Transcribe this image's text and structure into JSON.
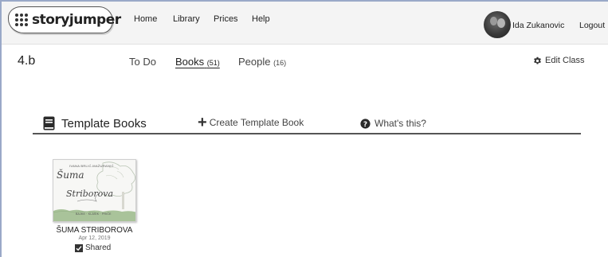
{
  "brand": {
    "name": "storyjumper"
  },
  "nav": {
    "home": "Home",
    "library": "Library",
    "prices": "Prices",
    "help": "Help"
  },
  "user": {
    "name": "Ida Zukanovic",
    "logout": "Logout"
  },
  "class": {
    "name": "4.b",
    "tabs": [
      {
        "label": "To Do",
        "count": ""
      },
      {
        "label": "Books",
        "count": "(51)"
      },
      {
        "label": "People",
        "count": "(16)"
      }
    ],
    "edit_label": "Edit Class"
  },
  "section": {
    "title": "Template Books",
    "create_label": "Create Template Book",
    "help_label": "What's this?"
  },
  "books": [
    {
      "title": "ŠUMA STRIBOROVA",
      "date": "Apr 12, 2019",
      "shared_label": "Shared",
      "shared": true,
      "cover_line1": "Šuma",
      "cover_line2": "Striborova"
    }
  ]
}
